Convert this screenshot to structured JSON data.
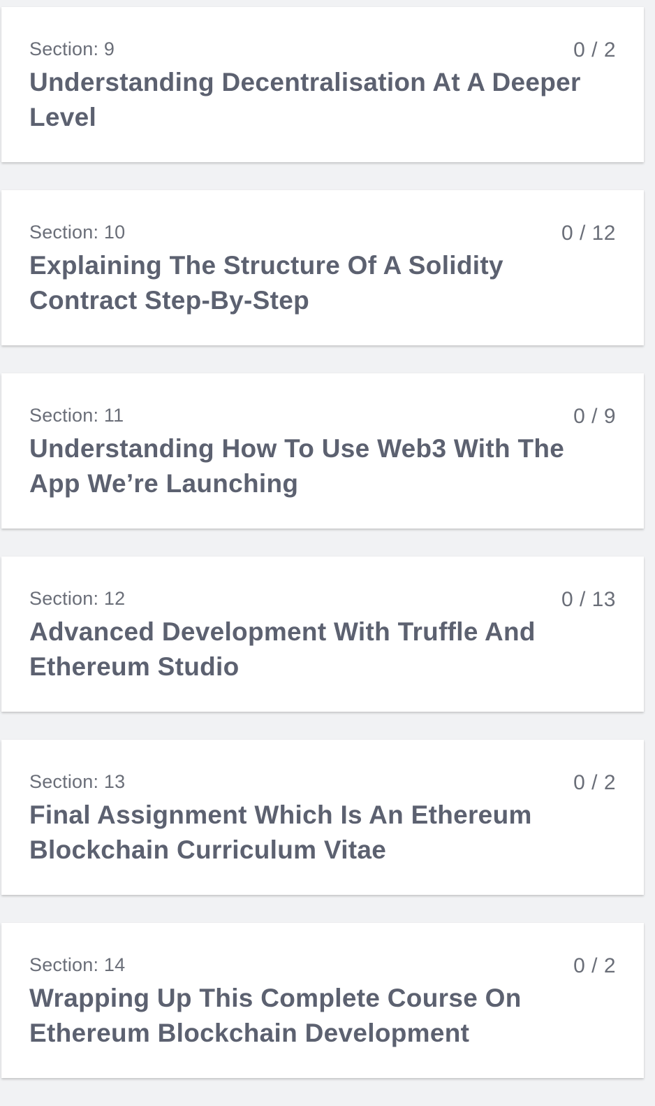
{
  "sections": [
    {
      "label": "Section: 9",
      "progress": "0 / 2",
      "title": "Understanding Decentralisation At A Deeper Level"
    },
    {
      "label": "Section: 10",
      "progress": "0 / 12",
      "title": "Explaining The Structure Of A Solidity Contract Step-By-Step"
    },
    {
      "label": "Section: 11",
      "progress": "0 / 9",
      "title": "Understanding How To Use Web3 With The App We’re Launching"
    },
    {
      "label": "Section: 12",
      "progress": "0 / 13",
      "title": "Advanced Development With Truffle And Ethereum Studio"
    },
    {
      "label": "Section: 13",
      "progress": "0 / 2",
      "title": "Final Assignment Which Is An Ethereum Blockchain Curriculum Vitae"
    },
    {
      "label": "Section: 14",
      "progress": "0 / 2",
      "title": "Wrapping Up This Complete Course On Ethereum Blockchain Development"
    }
  ]
}
